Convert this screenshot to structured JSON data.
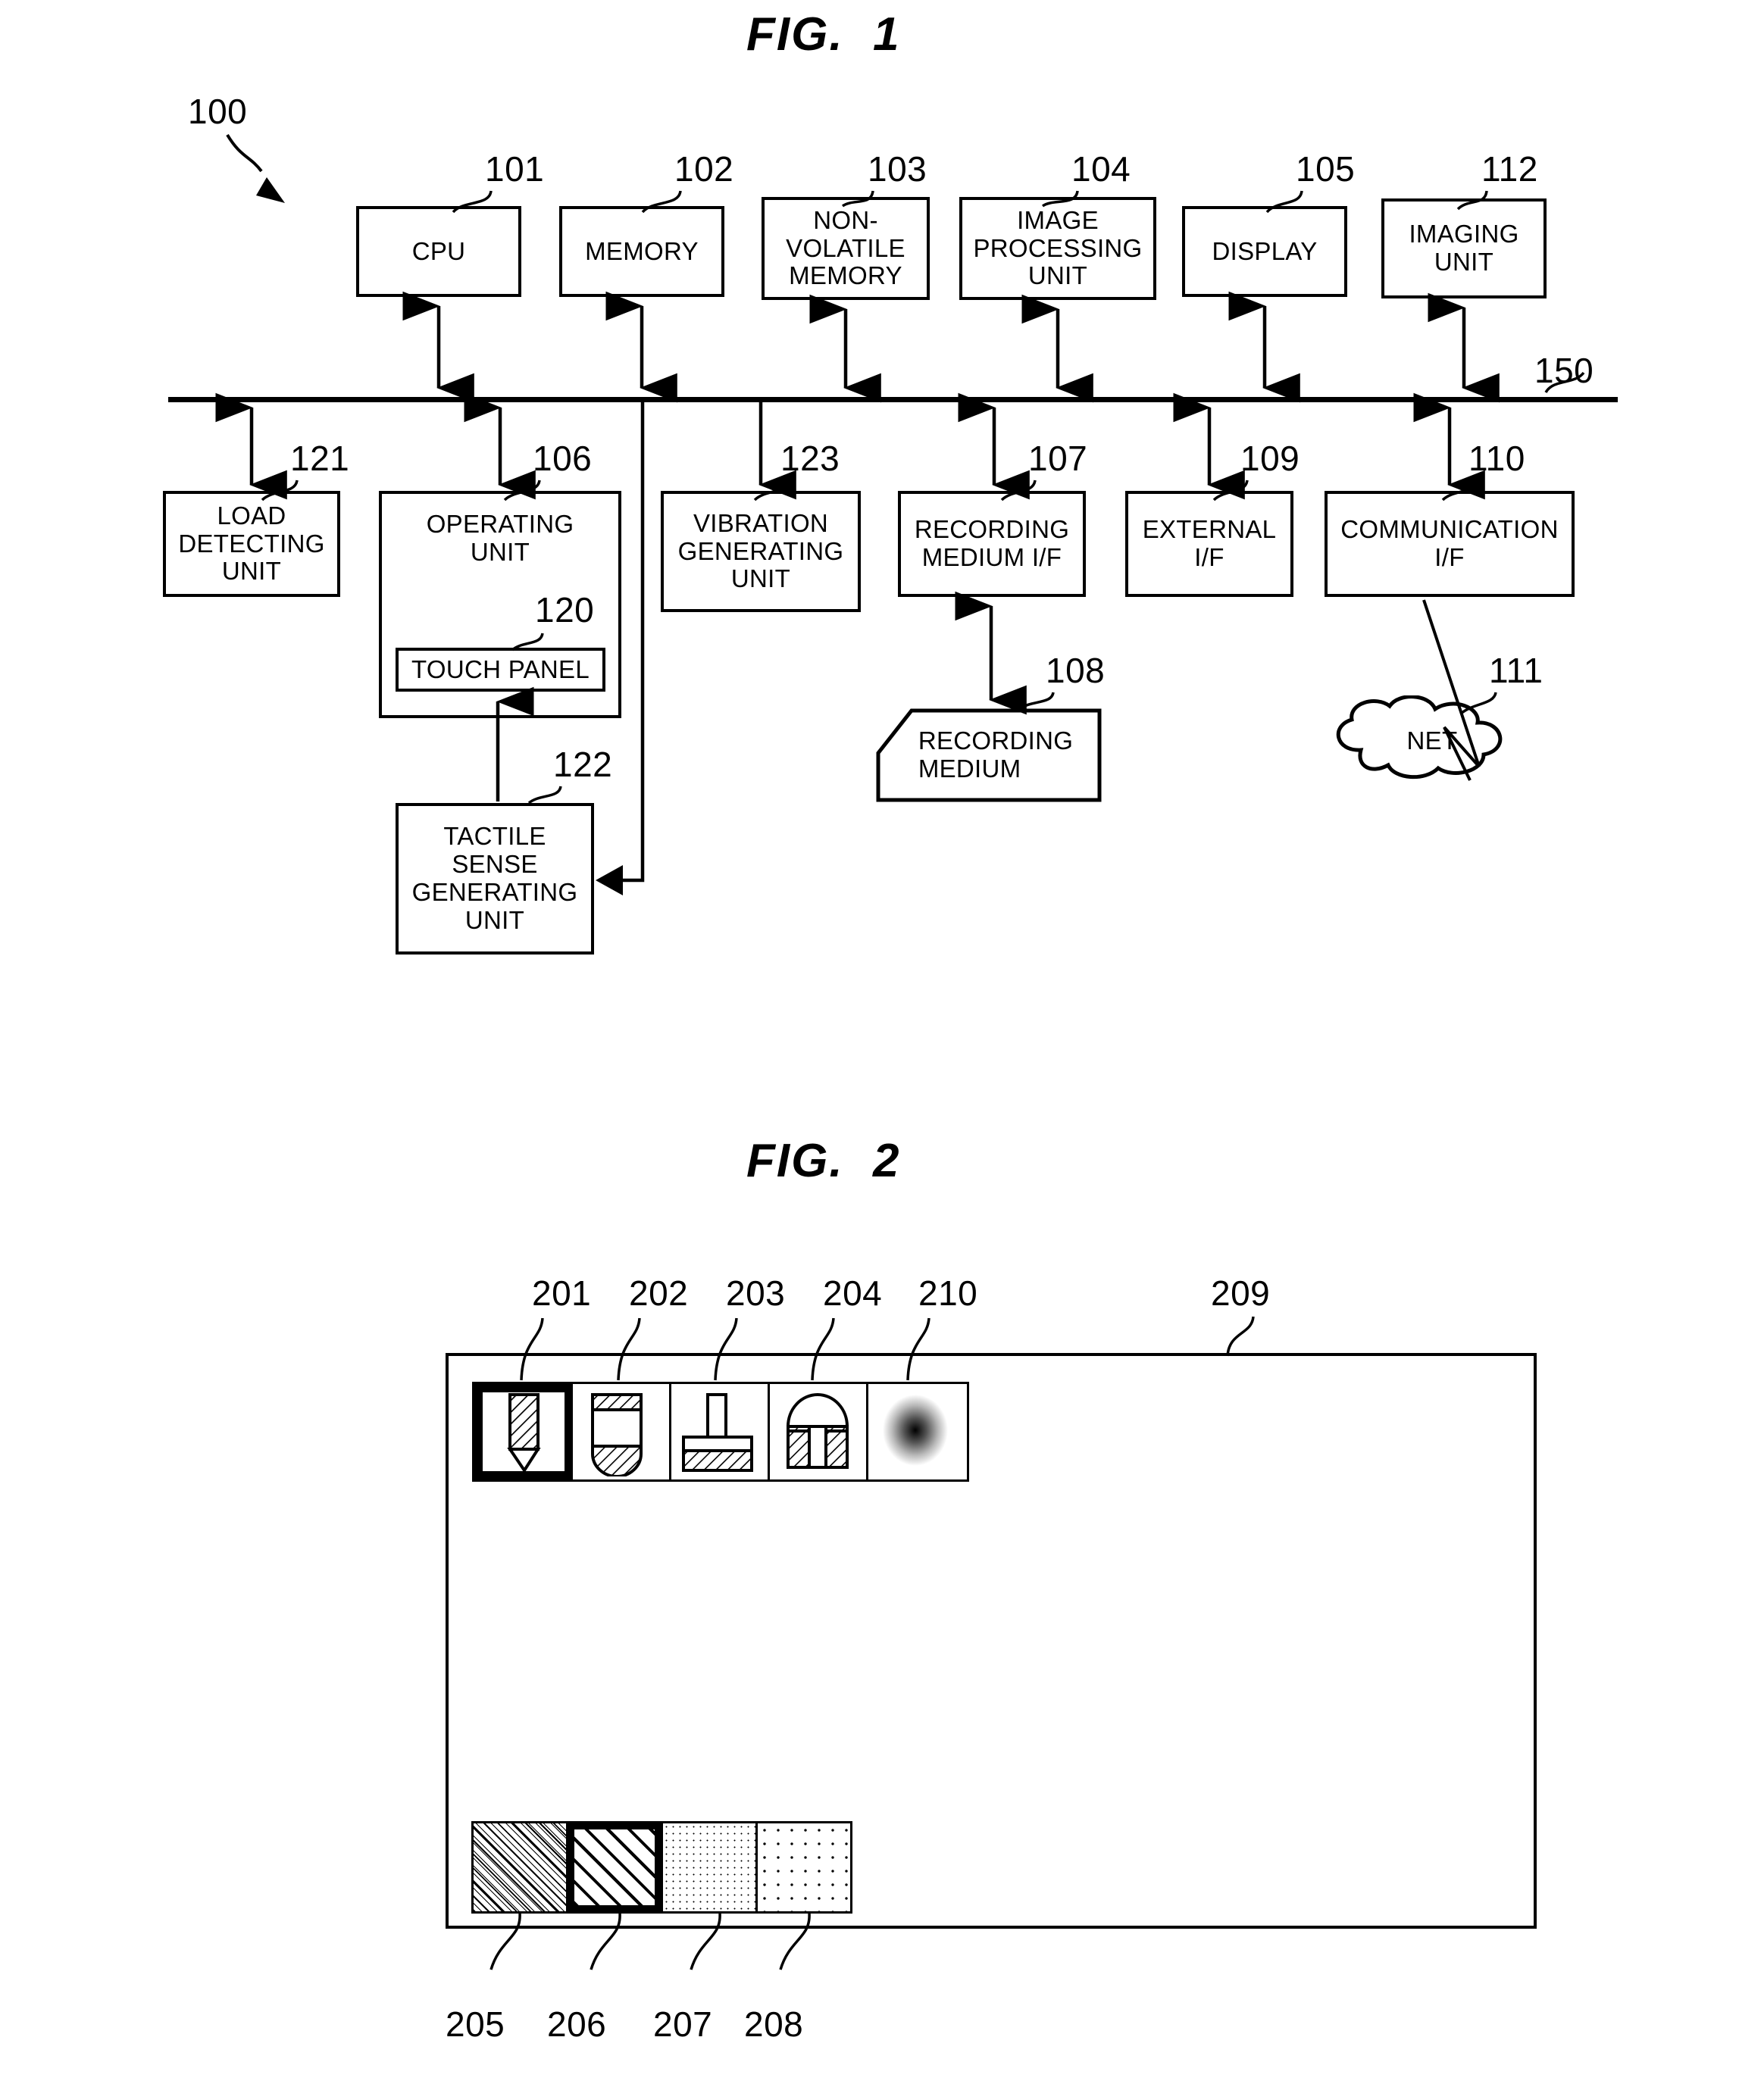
{
  "figures": [
    {
      "title": "FIG.  1",
      "system_ref": "100",
      "bus_ref": "150",
      "blocks": [
        {
          "id": "cpu",
          "ref": "101",
          "label": "CPU"
        },
        {
          "id": "memory",
          "ref": "102",
          "label": "MEMORY"
        },
        {
          "id": "non-volatile-memory",
          "ref": "103",
          "label": "NON-\nVOLATILE\nMEMORY"
        },
        {
          "id": "image-processing-unit",
          "ref": "104",
          "label": "IMAGE\nPROCESSING\nUNIT"
        },
        {
          "id": "display",
          "ref": "105",
          "label": "DISPLAY"
        },
        {
          "id": "imaging-unit",
          "ref": "112",
          "label": "IMAGING\nUNIT"
        },
        {
          "id": "load-detecting-unit",
          "ref": "121",
          "label": "LOAD\nDETECTING\nUNIT"
        },
        {
          "id": "operating-unit",
          "ref": "106",
          "label": "OPERATING\nUNIT"
        },
        {
          "id": "touch-panel",
          "ref": "120",
          "label": "TOUCH PANEL"
        },
        {
          "id": "vibration-generating-unit",
          "ref": "123",
          "label": "VIBRATION\nGENERATING\nUNIT"
        },
        {
          "id": "recording-medium-if",
          "ref": "107",
          "label": "RECORDING\nMEDIUM I/F"
        },
        {
          "id": "recording-medium",
          "ref": "108",
          "label": "RECORDING\nMEDIUM"
        },
        {
          "id": "external-if",
          "ref": "109",
          "label": "EXTERNAL\nI/F"
        },
        {
          "id": "communication-if",
          "ref": "110",
          "label": "COMMUNICATION\nI/F"
        },
        {
          "id": "net-cloud",
          "ref": "111",
          "label": "NET"
        },
        {
          "id": "tactile-sense-generating-unit",
          "ref": "122",
          "label": "TACTILE\nSENSE\nGENERATING\nUNIT"
        }
      ]
    },
    {
      "title": "FIG.  2",
      "screen_ref": "209",
      "tools": [
        {
          "ref": "201",
          "icon": "pen-icon",
          "selected": true
        },
        {
          "ref": "202",
          "icon": "marker-icon",
          "selected": false
        },
        {
          "ref": "203",
          "icon": "brush-icon",
          "selected": false
        },
        {
          "ref": "204",
          "icon": "eraser-icon",
          "selected": false
        },
        {
          "ref": "210",
          "icon": "airbrush-icon",
          "selected": false
        }
      ],
      "swatches": [
        {
          "ref": "205",
          "pattern": "dense-diagonal-hatch",
          "selected": false
        },
        {
          "ref": "206",
          "pattern": "wide-diagonal-hatch",
          "selected": true
        },
        {
          "ref": "207",
          "pattern": "fine-stipple",
          "selected": false
        },
        {
          "ref": "208",
          "pattern": "coarse-stipple",
          "selected": false
        }
      ]
    }
  ],
  "colors": {
    "ink": "#000000",
    "paper": "#ffffff"
  }
}
